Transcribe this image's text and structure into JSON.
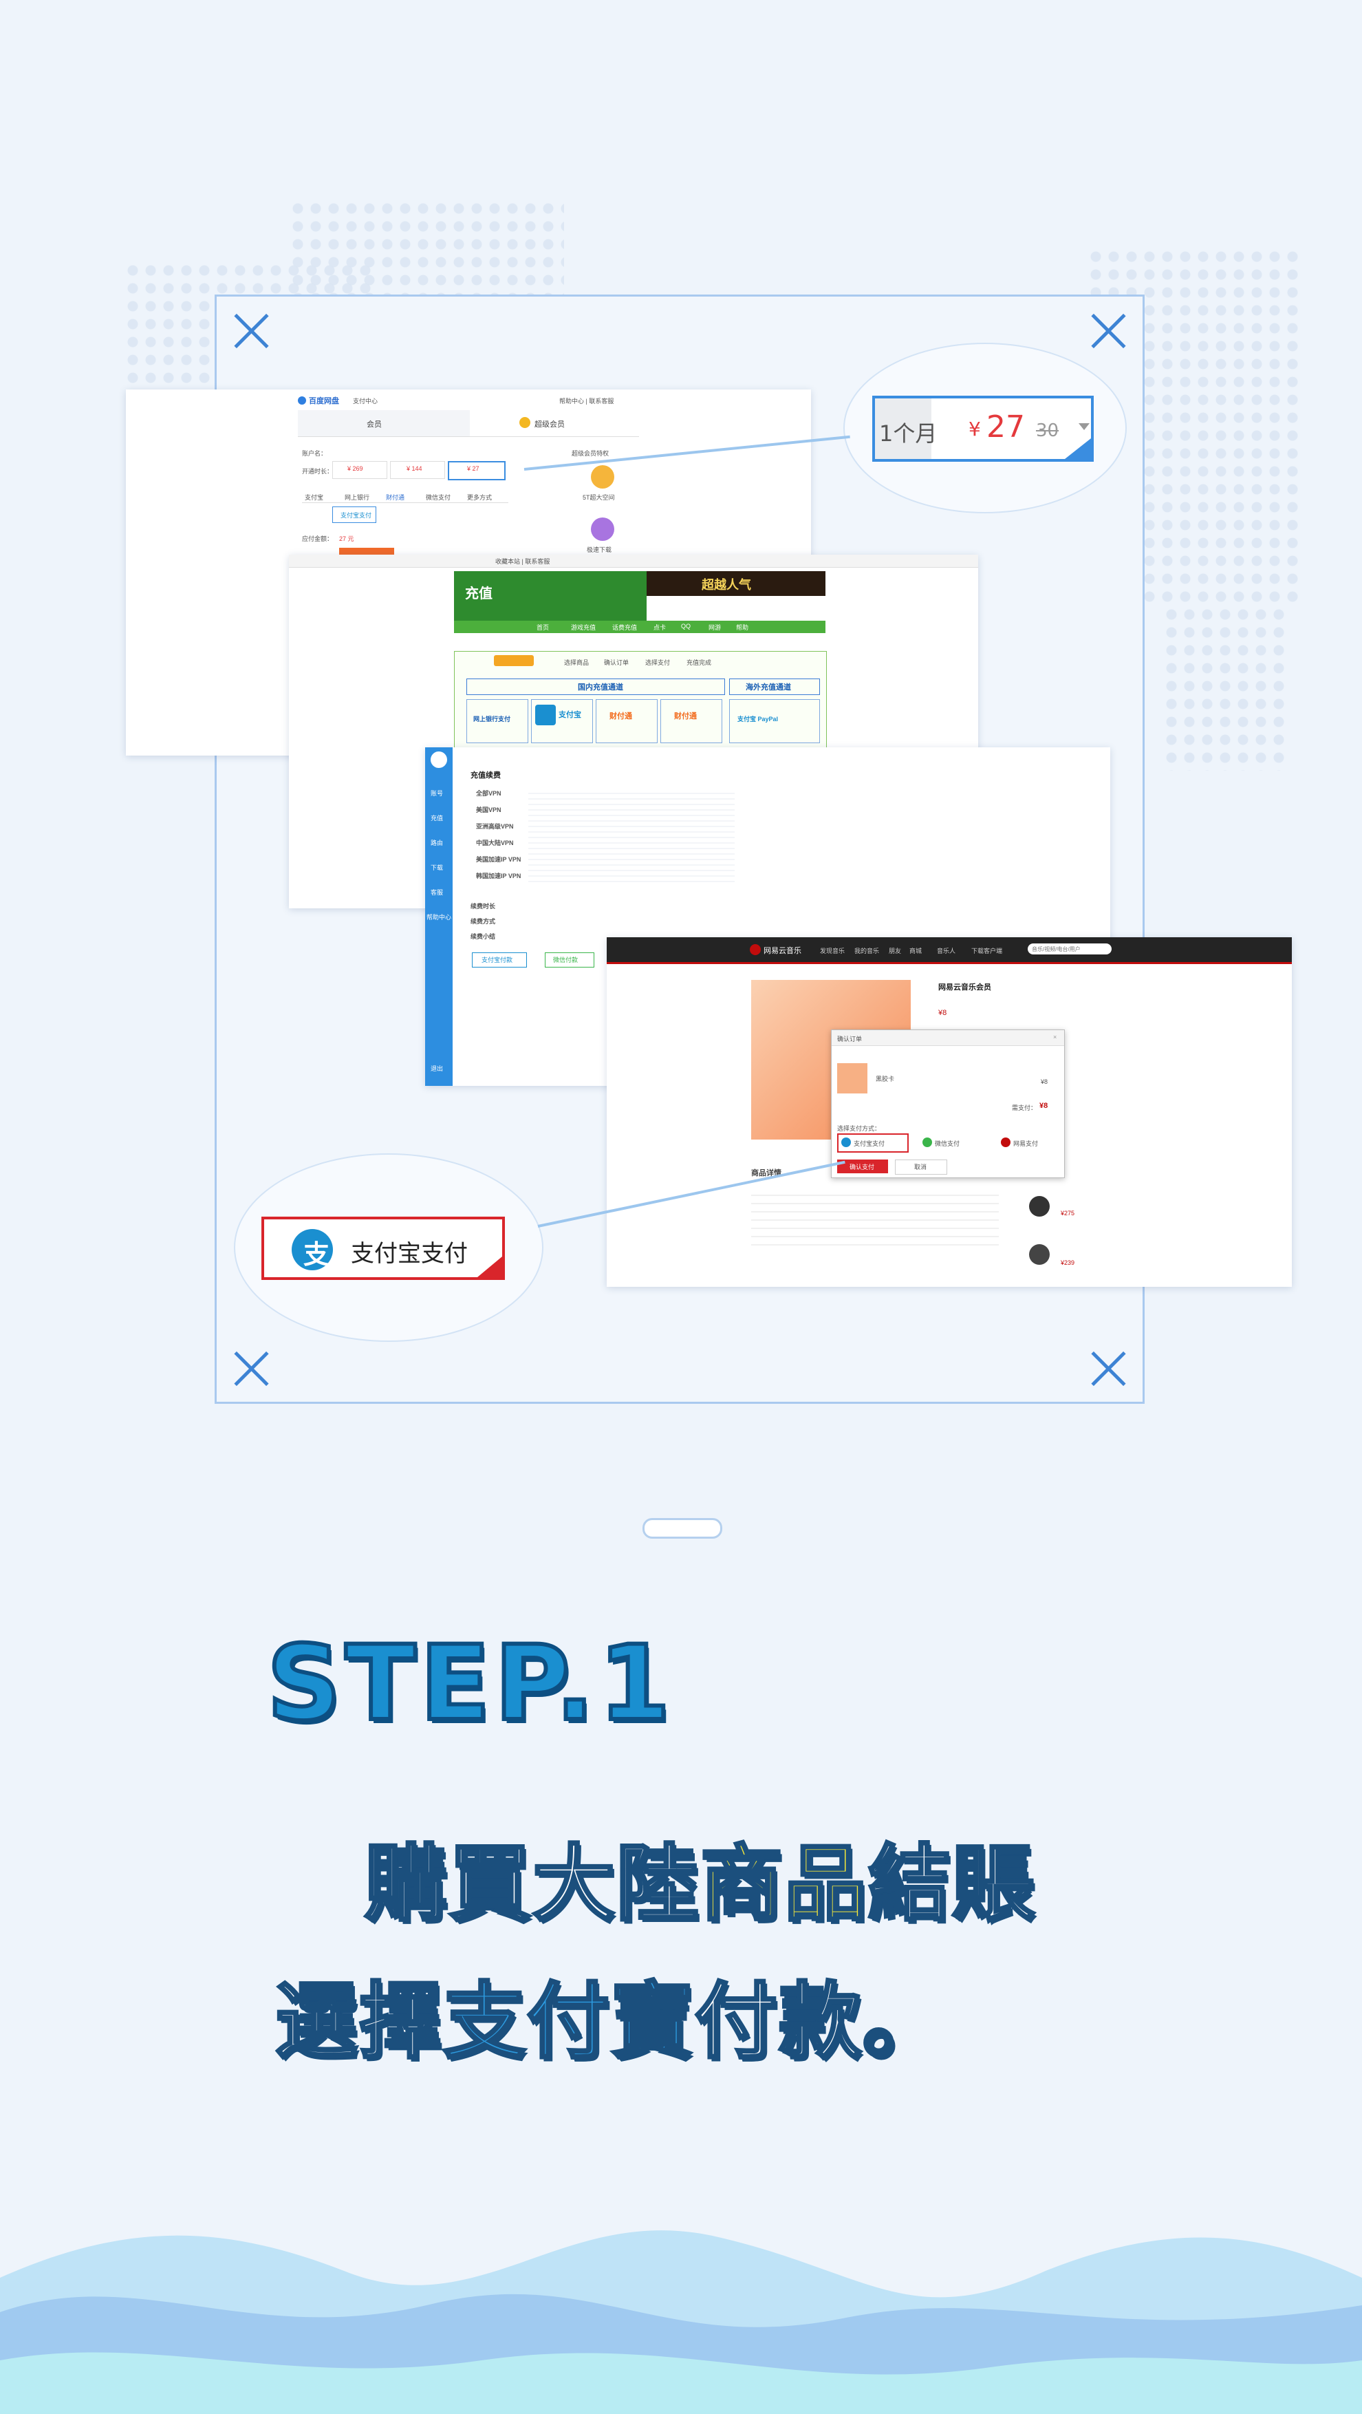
{
  "colors": {
    "accent": "#3d83d4",
    "alipay_blue": "#1a8fd0",
    "red": "#d9252b",
    "wave_light": "#b8ecf3",
    "wave_dark": "#9cc6ee"
  },
  "callout_price": {
    "duration": "1个月",
    "currency": "¥",
    "price": "27",
    "original_price": "30"
  },
  "callout_pay": {
    "label": "支付宝支付",
    "icon": "alipay-icon"
  },
  "baidu": {
    "brand": "百度网盘",
    "center": "支付中心",
    "top_links": "帮助中心 | 联系客服",
    "tab_vip": "会员",
    "tab_svip": "超级会员",
    "account": "账户名：",
    "months_label": "开通时长：",
    "opt_12": "¥ 269",
    "opt_6": "¥ 144",
    "opt_1": "¥ 27",
    "pay_methods": [
      "支付宝",
      "网上银行",
      "财付通",
      "微信支付",
      "更多方式"
    ],
    "pay_label": "支付宝支付",
    "amount_label": "应付金额：",
    "amount": "27 元",
    "side_title": "超级会员特权",
    "side_1": "5T超大空间",
    "side_2": "极速下载"
  },
  "ns": {
    "brand": "充值",
    "top_links": "收藏本站 | 联系客服",
    "banner": "超越人气",
    "nav": [
      "首页",
      "游戏充值",
      "话费充值",
      "点卡",
      "QQ",
      "网游",
      "帮助"
    ],
    "steps": [
      "选择商品",
      "确认订单",
      "选择支付",
      "充值完成"
    ],
    "domestic": "国内充值通道",
    "overseas": "海外充值通道",
    "methods": [
      "网上银行支付",
      "支付宝",
      "财付通",
      "财付通",
      "支付宝 PayPal"
    ]
  },
  "vpn": {
    "header": "充值续费",
    "sidebar": [
      "账号",
      "充值",
      "路由",
      "下载",
      "客服",
      "帮助中心",
      "退出"
    ],
    "plans": [
      "全部VPN",
      "美国VPN",
      "亚洲高级VPN",
      "中国大陆VPN",
      "美国加速IP VPN",
      "韩国加速IP VPN"
    ],
    "duration": "续费时长",
    "method": "续费方式",
    "pay": "续费小结",
    "btn_alipay": "支付宝付款",
    "btn_wechat": "微信付款"
  },
  "netease": {
    "brand": "网易云音乐",
    "nav": [
      "发现音乐",
      "我的音乐",
      "朋友",
      "商城",
      "音乐人",
      "下载客户端"
    ],
    "search_placeholder": "音乐/视频/电台/用户",
    "product": "网易云音乐会员",
    "price": "¥8",
    "dialog_title": "确认订单",
    "item": "黑胶卡",
    "item_price": "¥8",
    "total_label": "需支付：",
    "total": "¥8",
    "method_label": "选择支付方式：",
    "methods": [
      "支付宝支付",
      "微信支付",
      "网易支付"
    ],
    "confirm": "确认支付",
    "cancel": "取消",
    "details": "商品详情",
    "side_price1": "¥275",
    "side_price2": "¥239"
  },
  "headline": {
    "step": "STEP.1",
    "line1_a": "購買大陸",
    "line1_b": "商品",
    "line1_c": "結賬",
    "line2_a": "選擇",
    "line2_b": "支付寶",
    "line2_c": "付款。"
  }
}
